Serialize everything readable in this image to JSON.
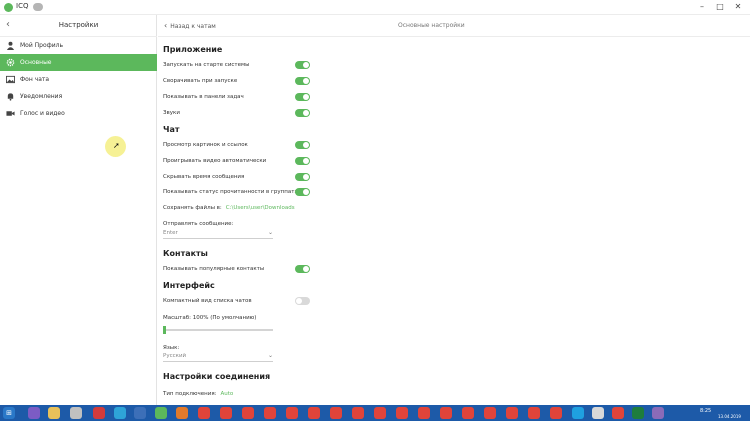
{
  "titlebar": {
    "app_name": "ICQ",
    "minimize": "–",
    "maximize": "□",
    "close": "✕"
  },
  "left": {
    "back": "‹",
    "title": "Настройки",
    "items": [
      {
        "label": "Мой Профиль",
        "icon": "person-icon",
        "active": false
      },
      {
        "label": "Основные",
        "icon": "gear-icon",
        "active": true
      },
      {
        "label": "Фон чата",
        "icon": "image-icon",
        "active": false
      },
      {
        "label": "Уведомления",
        "icon": "bell-icon",
        "active": false
      },
      {
        "label": "Голос и видео",
        "icon": "camera-icon",
        "active": false
      }
    ]
  },
  "right": {
    "back_label": "Назад к чатам",
    "title": "Основные настройки",
    "app_section": "Приложение",
    "app_rows": [
      {
        "label": "Запускать на старте системы",
        "on": true
      },
      {
        "label": "Сворачивать при запуске",
        "on": true
      },
      {
        "label": "Показывать в панели задач",
        "on": true
      },
      {
        "label": "Звуки",
        "on": true
      }
    ],
    "chat_section": "Чат",
    "chat_rows": [
      {
        "label": "Просмотр картинок и ссылок",
        "on": true
      },
      {
        "label": "Проигрывать видео автоматически",
        "on": true
      },
      {
        "label": "Скрывать время сообщения",
        "on": true
      },
      {
        "label": "Показывать статус прочитанности в группатах",
        "on": true
      }
    ],
    "save_files_label": "Сохранять файлы в:",
    "save_files_path": "C:\\Users\\user\\Downloads",
    "send_label": "Отправлять сообщение:",
    "send_value": "Enter",
    "contacts_section": "Контакты",
    "contacts_row": {
      "label": "Показывать популярные контакты",
      "on": true
    },
    "interface_section": "Интерфейс",
    "interface_row": {
      "label": "Компактный вид списка чатов",
      "on": false
    },
    "scale_label": "Масштаб: 100% (По умолчанию)",
    "scale_fraction": 0.0,
    "language_label": "Язык:",
    "language_value": "Русский",
    "connection_section": "Настройки соединения",
    "connection_type_label": "Тип подключения:",
    "connection_type_value": "Auto"
  },
  "taskbar": {
    "start": "⊞",
    "tray_time": "8:25",
    "tray_date": "13.04.2019",
    "accent": "#1d5aa8"
  },
  "colors": {
    "accent": "#5cb85c"
  }
}
